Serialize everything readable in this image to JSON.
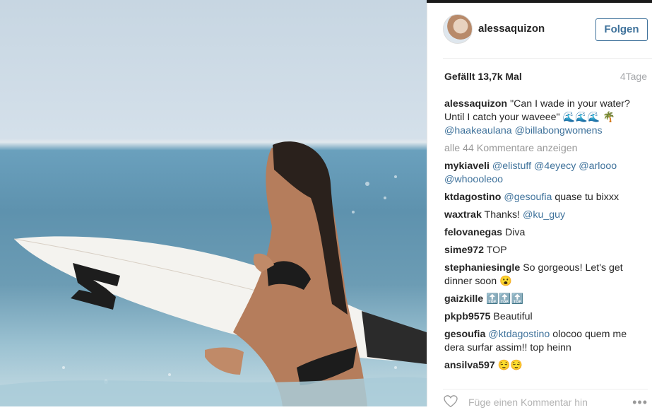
{
  "post": {
    "username": "alessaquizon",
    "follow_label": "Folgen",
    "likes": "Gefällt 13,7k Mal",
    "time_ago": "4Tage",
    "caption_user": "alessaquizon",
    "caption_text": "\"Can I wade in your water? Until I catch your waveee\" 🌊🌊🌊 🌴",
    "caption_mentions": [
      "@haakeaulana",
      "@billabongwomens"
    ],
    "view_all_comments": "alle 44 Kommentare anzeigen",
    "add_comment_placeholder": "Füge einen Kommentar hin",
    "more_options": "•••"
  },
  "comments": [
    {
      "user": "mykiaveli",
      "mentions": [
        "@elistuff",
        "@4eyecy",
        "@arlooo",
        "@whoooleoo"
      ],
      "text": ""
    },
    {
      "user": "ktdagostino",
      "mentions": [
        "@gesoufia"
      ],
      "text": "quase tu bixxx"
    },
    {
      "user": "waxtrak",
      "pre": "Thanks!",
      "mentions": [
        "@ku_guy"
      ],
      "text": ""
    },
    {
      "user": "felovanegas",
      "text": "Diva"
    },
    {
      "user": "sime972",
      "text": "TOP"
    },
    {
      "user": "stephaniesingle",
      "text": "So gorgeous! Let's get dinner soon 😮"
    },
    {
      "user": "gaizkille",
      "text": "🔝🔝🔝"
    },
    {
      "user": "pkpb9575",
      "text": "Beautiful"
    },
    {
      "user": "gesoufia",
      "mentions": [
        "@ktdagostino"
      ],
      "text": "olocoo quem me dera surfar assim!! top heinn"
    },
    {
      "user": "ansilva597",
      "text": "😌😌"
    }
  ],
  "colors": {
    "link": "#3f729b",
    "muted": "#999999",
    "text": "#262626"
  }
}
